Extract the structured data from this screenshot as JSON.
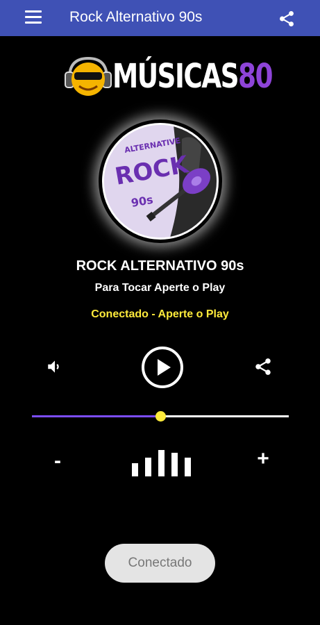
{
  "appbar": {
    "title": "Rock Alternativo 90s",
    "menu_icon": "hamburger-menu-icon",
    "share_icon": "share-icon",
    "color": "#3f51b5"
  },
  "logo": {
    "text_main": "MÚSICAS",
    "text_num": "80",
    "accent_color": "#8e44d8"
  },
  "cover": {
    "line1": "ALTERNATIVE",
    "line2": "ROCK",
    "line3": "90s"
  },
  "player": {
    "station_name": "ROCK ALTERNATIVO 90s",
    "subtitle": "Para Tocar Aperte o Play",
    "status": "Conectado - Aperte o Play",
    "status_color": "#ffeb3b",
    "volume_icon": "volume-icon",
    "play_icon": "play-icon",
    "share_icon": "share-icon",
    "volume_level": 0.5,
    "minus_label": "-",
    "plus_label": "+",
    "equalizer_levels": [
      0.45,
      0.65,
      0.9,
      0.8,
      0.65
    ]
  },
  "footer": {
    "button_label": "Conectado"
  }
}
